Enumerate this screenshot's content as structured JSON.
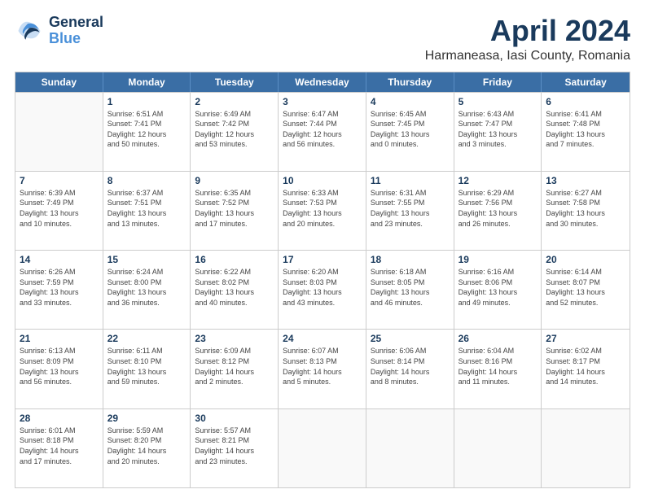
{
  "header": {
    "logo_line1": "General",
    "logo_line2": "Blue",
    "title": "April 2024",
    "subtitle": "Harmaneasa, Iasi County, Romania"
  },
  "days": [
    "Sunday",
    "Monday",
    "Tuesday",
    "Wednesday",
    "Thursday",
    "Friday",
    "Saturday"
  ],
  "rows": [
    [
      {
        "date": "",
        "info": ""
      },
      {
        "date": "1",
        "info": "Sunrise: 6:51 AM\nSunset: 7:41 PM\nDaylight: 12 hours\nand 50 minutes."
      },
      {
        "date": "2",
        "info": "Sunrise: 6:49 AM\nSunset: 7:42 PM\nDaylight: 12 hours\nand 53 minutes."
      },
      {
        "date": "3",
        "info": "Sunrise: 6:47 AM\nSunset: 7:44 PM\nDaylight: 12 hours\nand 56 minutes."
      },
      {
        "date": "4",
        "info": "Sunrise: 6:45 AM\nSunset: 7:45 PM\nDaylight: 13 hours\nand 0 minutes."
      },
      {
        "date": "5",
        "info": "Sunrise: 6:43 AM\nSunset: 7:47 PM\nDaylight: 13 hours\nand 3 minutes."
      },
      {
        "date": "6",
        "info": "Sunrise: 6:41 AM\nSunset: 7:48 PM\nDaylight: 13 hours\nand 7 minutes."
      }
    ],
    [
      {
        "date": "7",
        "info": "Sunrise: 6:39 AM\nSunset: 7:49 PM\nDaylight: 13 hours\nand 10 minutes."
      },
      {
        "date": "8",
        "info": "Sunrise: 6:37 AM\nSunset: 7:51 PM\nDaylight: 13 hours\nand 13 minutes."
      },
      {
        "date": "9",
        "info": "Sunrise: 6:35 AM\nSunset: 7:52 PM\nDaylight: 13 hours\nand 17 minutes."
      },
      {
        "date": "10",
        "info": "Sunrise: 6:33 AM\nSunset: 7:53 PM\nDaylight: 13 hours\nand 20 minutes."
      },
      {
        "date": "11",
        "info": "Sunrise: 6:31 AM\nSunset: 7:55 PM\nDaylight: 13 hours\nand 23 minutes."
      },
      {
        "date": "12",
        "info": "Sunrise: 6:29 AM\nSunset: 7:56 PM\nDaylight: 13 hours\nand 26 minutes."
      },
      {
        "date": "13",
        "info": "Sunrise: 6:27 AM\nSunset: 7:58 PM\nDaylight: 13 hours\nand 30 minutes."
      }
    ],
    [
      {
        "date": "14",
        "info": "Sunrise: 6:26 AM\nSunset: 7:59 PM\nDaylight: 13 hours\nand 33 minutes."
      },
      {
        "date": "15",
        "info": "Sunrise: 6:24 AM\nSunset: 8:00 PM\nDaylight: 13 hours\nand 36 minutes."
      },
      {
        "date": "16",
        "info": "Sunrise: 6:22 AM\nSunset: 8:02 PM\nDaylight: 13 hours\nand 40 minutes."
      },
      {
        "date": "17",
        "info": "Sunrise: 6:20 AM\nSunset: 8:03 PM\nDaylight: 13 hours\nand 43 minutes."
      },
      {
        "date": "18",
        "info": "Sunrise: 6:18 AM\nSunset: 8:05 PM\nDaylight: 13 hours\nand 46 minutes."
      },
      {
        "date": "19",
        "info": "Sunrise: 6:16 AM\nSunset: 8:06 PM\nDaylight: 13 hours\nand 49 minutes."
      },
      {
        "date": "20",
        "info": "Sunrise: 6:14 AM\nSunset: 8:07 PM\nDaylight: 13 hours\nand 52 minutes."
      }
    ],
    [
      {
        "date": "21",
        "info": "Sunrise: 6:13 AM\nSunset: 8:09 PM\nDaylight: 13 hours\nand 56 minutes."
      },
      {
        "date": "22",
        "info": "Sunrise: 6:11 AM\nSunset: 8:10 PM\nDaylight: 13 hours\nand 59 minutes."
      },
      {
        "date": "23",
        "info": "Sunrise: 6:09 AM\nSunset: 8:12 PM\nDaylight: 14 hours\nand 2 minutes."
      },
      {
        "date": "24",
        "info": "Sunrise: 6:07 AM\nSunset: 8:13 PM\nDaylight: 14 hours\nand 5 minutes."
      },
      {
        "date": "25",
        "info": "Sunrise: 6:06 AM\nSunset: 8:14 PM\nDaylight: 14 hours\nand 8 minutes."
      },
      {
        "date": "26",
        "info": "Sunrise: 6:04 AM\nSunset: 8:16 PM\nDaylight: 14 hours\nand 11 minutes."
      },
      {
        "date": "27",
        "info": "Sunrise: 6:02 AM\nSunset: 8:17 PM\nDaylight: 14 hours\nand 14 minutes."
      }
    ],
    [
      {
        "date": "28",
        "info": "Sunrise: 6:01 AM\nSunset: 8:18 PM\nDaylight: 14 hours\nand 17 minutes."
      },
      {
        "date": "29",
        "info": "Sunrise: 5:59 AM\nSunset: 8:20 PM\nDaylight: 14 hours\nand 20 minutes."
      },
      {
        "date": "30",
        "info": "Sunrise: 5:57 AM\nSunset: 8:21 PM\nDaylight: 14 hours\nand 23 minutes."
      },
      {
        "date": "",
        "info": ""
      },
      {
        "date": "",
        "info": ""
      },
      {
        "date": "",
        "info": ""
      },
      {
        "date": "",
        "info": ""
      }
    ]
  ]
}
